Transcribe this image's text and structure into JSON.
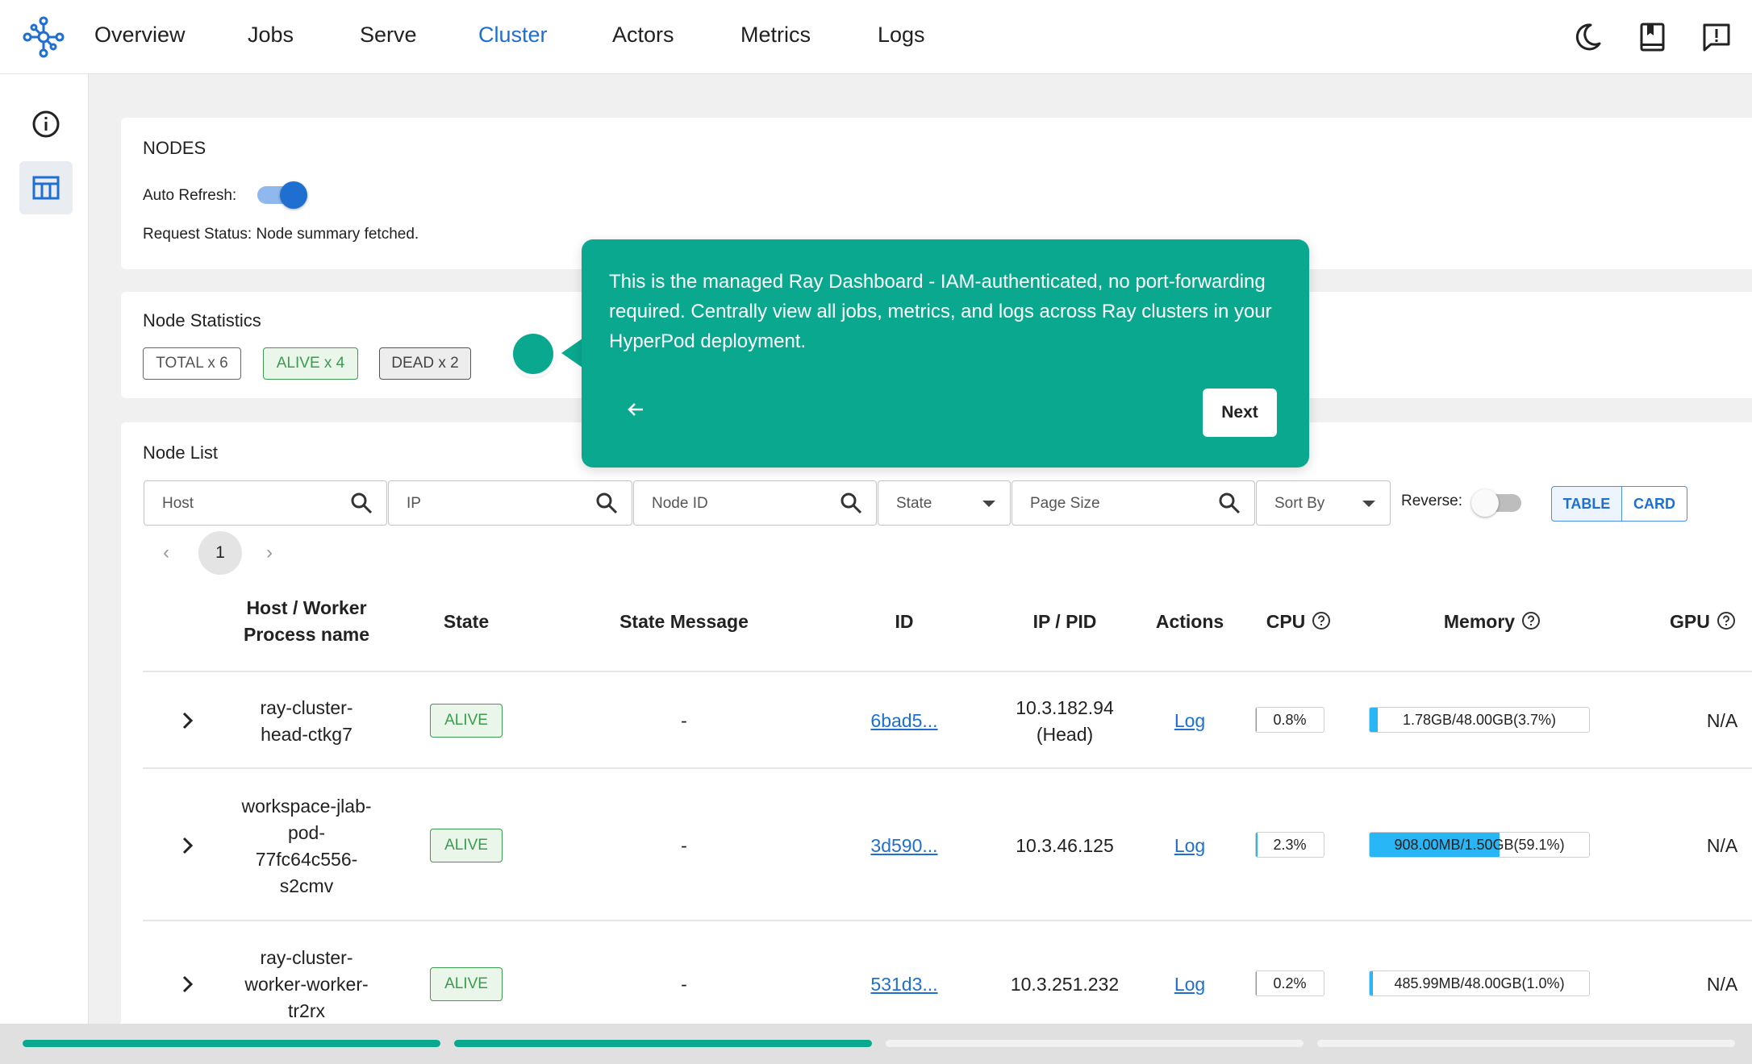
{
  "nav": {
    "links": [
      "Overview",
      "Jobs",
      "Serve",
      "Cluster",
      "Actors",
      "Metrics",
      "Logs"
    ],
    "active": "Cluster",
    "icons": [
      "ray-logo-icon",
      "moon-icon",
      "book-icon",
      "feedback-icon"
    ]
  },
  "rail": {
    "icons": [
      "info-icon",
      "table-icon"
    ]
  },
  "nodes_card": {
    "title": "NODES",
    "auto_refresh_label": "Auto Refresh:",
    "auto_refresh_on": true,
    "request_status": "Request Status: Node summary fetched."
  },
  "stats_card": {
    "title": "Node Statistics",
    "total": "TOTAL x 6",
    "alive": "ALIVE x 4",
    "dead": "DEAD x 2"
  },
  "list_card": {
    "title": "Node List",
    "filters": {
      "host": "Host",
      "ip": "IP",
      "node_id": "Node ID",
      "state": "State",
      "page_size": "Page Size",
      "sort_by": "Sort By"
    },
    "reverse_label": "Reverse:",
    "reverse_on": false,
    "view_table": "TABLE",
    "view_card": "CARD",
    "page": "1",
    "columns": {
      "host_line1": "Host / Worker",
      "host_line2": "Process name",
      "state": "State",
      "state_message": "State Message",
      "id": "ID",
      "ip_pid": "IP / PID",
      "actions": "Actions",
      "cpu": "CPU",
      "memory": "Memory",
      "gpu": "GPU"
    },
    "rows": [
      {
        "host_lines": [
          "ray-cluster-",
          "head-ctkg7"
        ],
        "state": "ALIVE",
        "message": "-",
        "id": "6bad5...",
        "ip_lines": [
          "10.3.182.94",
          "(Head)"
        ],
        "action": "Log",
        "cpu": "0.8%",
        "cpu_pct": 0.8,
        "memory": "1.78GB/48.00GB(3.7%)",
        "memory_pct": 3.7,
        "gpu": "N/A"
      },
      {
        "host_lines": [
          "workspace-jlab-",
          "pod-",
          "77fc64c556-",
          "s2cmv"
        ],
        "state": "ALIVE",
        "message": "-",
        "id": "3d590...",
        "ip_lines": [
          "10.3.46.125"
        ],
        "action": "Log",
        "cpu": "2.3%",
        "cpu_pct": 2.3,
        "memory": "908.00MB/1.50GB(59.1%)",
        "memory_pct": 59.1,
        "gpu": "N/A"
      },
      {
        "host_lines": [
          "ray-cluster-",
          "worker-worker-",
          "tr2rx"
        ],
        "state": "ALIVE",
        "message": "-",
        "id": "531d3...",
        "ip_lines": [
          "10.3.251.232"
        ],
        "action": "Log",
        "cpu": "0.2%",
        "cpu_pct": 0.2,
        "memory": "485.99MB/48.00GB(1.0%)",
        "memory_pct": 1.0,
        "gpu": "N/A"
      }
    ]
  },
  "tour": {
    "text": "This is the managed Ray Dashboard - IAM-authenticated, no port-forwarding required. Centrally view all jobs, metrics, and logs across Ray clusters in your HyperPod deployment.",
    "next_label": "Next"
  },
  "scroll_progress": {
    "segments": 4,
    "completed": 2
  },
  "colors": {
    "accent": "#1e6fd0",
    "tour": "#0aa88f",
    "alive": "#3b9b4f",
    "memory_bar": "#29b6f6"
  }
}
